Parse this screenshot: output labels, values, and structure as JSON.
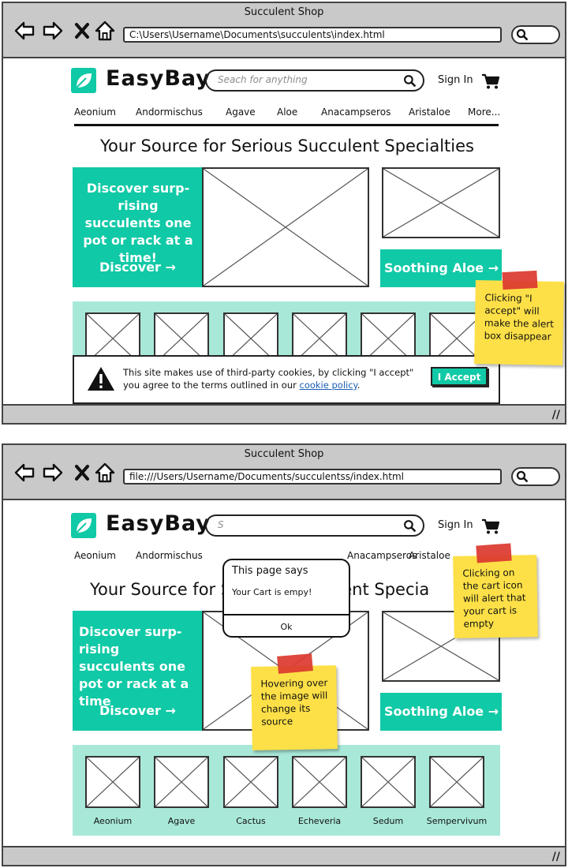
{
  "wireframes": [
    {
      "window_title": "Succulent Shop",
      "url": "C:\\Users\\Username\\Documents\\succulents\\index.html",
      "brand": "EasyBay",
      "search_placeholder": "Seach for anything",
      "sign_in": "Sign In",
      "categories": [
        "Aeonium",
        "Andormischus",
        "Agave",
        "Aloe",
        "Anacampseros",
        "Aristaloe",
        "More..."
      ],
      "tagline": "Your Source for Serious Succulent Specialties",
      "promo_text": "Discover surp-rising succulents one pot or rack at a time!",
      "promo_button": "Discover →",
      "aloe_button": "Soothing Aloe →",
      "cookie": {
        "text_before": "This site makes use of third-party cookies, by clicking \"I accept\" you agree to the terms outlined in our ",
        "link": "cookie policy",
        "text_after": ".",
        "accept_button": "I Accept"
      },
      "sticky_note": "Clicking \"I accept\" will make the alert box disappear"
    },
    {
      "window_title": "Succulent Shop",
      "url": "file:///Users/Username/Documents/succulentss/index.html",
      "brand": "EasyBay",
      "search_placeholder": "S",
      "sign_in": "Sign In",
      "categories": [
        "Aeonium",
        "Andormischus",
        "Anacampseros",
        "Aristaloe"
      ],
      "tagline": "Your Source for Serious Succulent Specia",
      "promo_text": "Discover surp-rising succulents one pot or rack at a time",
      "promo_button": "Discover →",
      "aloe_button": "Soothing Aloe →",
      "thumbnails": [
        "Aeonium",
        "Agave",
        "Cactus",
        "Echeveria",
        "Sedum",
        "Sempervivum"
      ],
      "alert": {
        "title": "This page says",
        "message": "Your Cart is empy!",
        "ok": "Ok"
      },
      "sticky_cart": "Clicking on the cart icon will alert that your cart is empty",
      "sticky_hover": "Hovering over the image will change its source"
    }
  ],
  "colors": {
    "accent": "#10c9a6",
    "strip": "#a8e8d8",
    "chrome": "#c9c9c9",
    "sticky": "#fde047",
    "tape": "#dc3a2f"
  }
}
